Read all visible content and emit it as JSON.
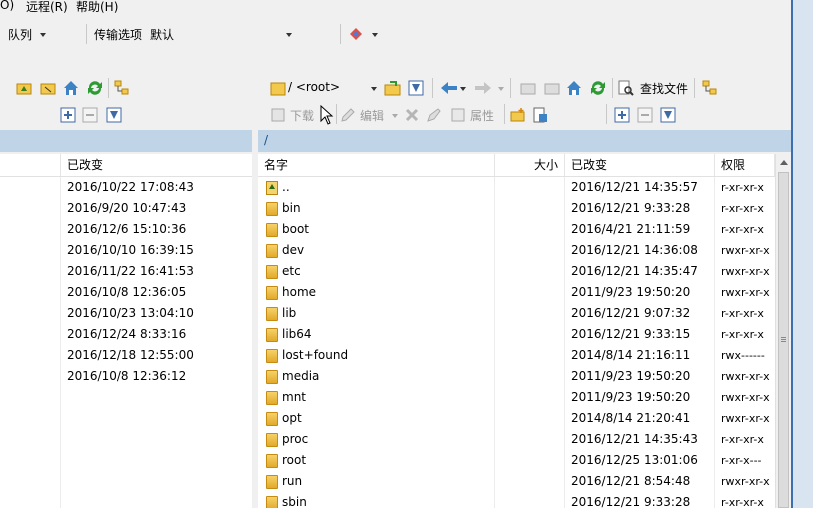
{
  "menu": {
    "item1": "O)",
    "item2": "远程(R)",
    "item3": "帮助(H)"
  },
  "toolbar": {
    "queue_label": "队列",
    "transfer_label": "传输选项",
    "transfer_value": "默认"
  },
  "right_nav": {
    "path_value": "/ <root>",
    "find_files_label": "查找文件",
    "download_label": "下载",
    "edit_label": "编辑",
    "properties_label": "属性"
  },
  "left_pane": {
    "header_modified": "已改变",
    "rows": [
      "2016/10/22  17:08:43",
      "2016/9/20  10:47:43",
      "2016/12/6  15:10:36",
      "2016/10/10  16:39:15",
      "2016/11/22  16:41:53",
      "2016/10/8  12:36:05",
      "2016/10/23  13:04:10",
      "2016/12/24  8:33:16",
      "2016/12/18  12:55:00",
      "2016/10/8  12:36:12"
    ]
  },
  "right_pane": {
    "path": "/",
    "header_name": "名字",
    "header_size": "大小",
    "header_modified": "已改变",
    "header_perms": "权限",
    "rows": [
      {
        "name": "..",
        "modified": "2016/12/21 14:35:57",
        "perms": "r-xr-xr-x"
      },
      {
        "name": "bin",
        "modified": "2016/12/21 9:33:28",
        "perms": "r-xr-xr-x"
      },
      {
        "name": "boot",
        "modified": "2016/4/21 21:11:59",
        "perms": "r-xr-xr-x"
      },
      {
        "name": "dev",
        "modified": "2016/12/21 14:36:08",
        "perms": "rwxr-xr-x"
      },
      {
        "name": "etc",
        "modified": "2016/12/21 14:35:47",
        "perms": "rwxr-xr-x"
      },
      {
        "name": "home",
        "modified": "2011/9/23 19:50:20",
        "perms": "rwxr-xr-x"
      },
      {
        "name": "lib",
        "modified": "2016/12/21 9:07:32",
        "perms": "r-xr-xr-x"
      },
      {
        "name": "lib64",
        "modified": "2016/12/21 9:33:15",
        "perms": "r-xr-xr-x"
      },
      {
        "name": "lost+found",
        "modified": "2014/8/14 21:16:11",
        "perms": "rwx------"
      },
      {
        "name": "media",
        "modified": "2011/9/23 19:50:20",
        "perms": "rwxr-xr-x"
      },
      {
        "name": "mnt",
        "modified": "2011/9/23 19:50:20",
        "perms": "rwxr-xr-x"
      },
      {
        "name": "opt",
        "modified": "2014/8/14 21:20:41",
        "perms": "rwxr-xr-x"
      },
      {
        "name": "proc",
        "modified": "2016/12/21 14:35:43",
        "perms": "r-xr-xr-x"
      },
      {
        "name": "root",
        "modified": "2016/12/25 13:01:06",
        "perms": "r-xr-x---"
      },
      {
        "name": "run",
        "modified": "2016/12/21 8:54:48",
        "perms": "rwxr-xr-x"
      },
      {
        "name": "sbin",
        "modified": "2016/12/21 9:33:28",
        "perms": "r-xr-xr-x"
      }
    ]
  }
}
